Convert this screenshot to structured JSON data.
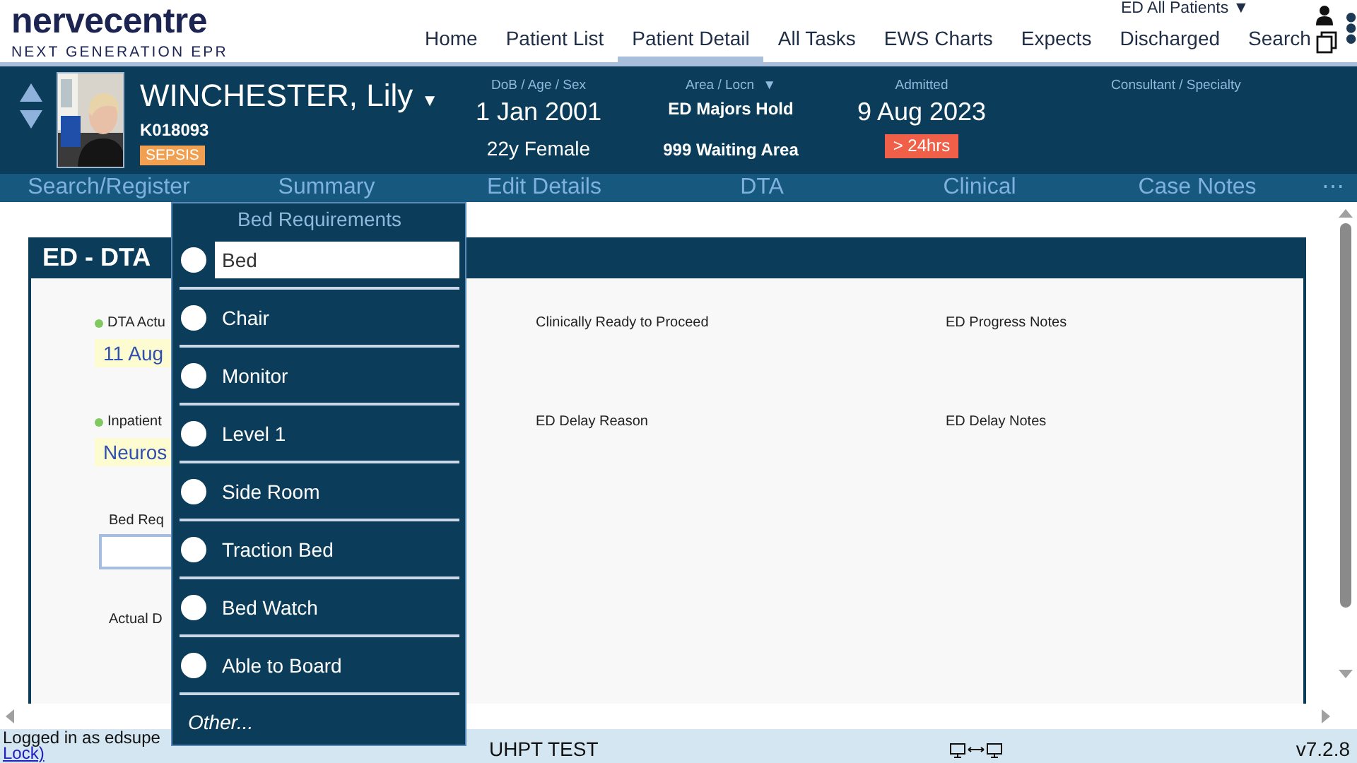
{
  "logo": {
    "name": "nervecentre",
    "tagline": "NEXT GENERATION EPR"
  },
  "nav": [
    {
      "label": "Home",
      "selected": false
    },
    {
      "label": "Patient List",
      "selected": false
    },
    {
      "label": "Patient Detail",
      "selected": true
    },
    {
      "label": "All Tasks",
      "selected": false
    },
    {
      "label": "EWS Charts",
      "selected": false
    },
    {
      "label": "Expects",
      "selected": false
    },
    {
      "label": "Discharged",
      "selected": false
    },
    {
      "label": "Search",
      "selected": false
    }
  ],
  "ward_selector": {
    "label": "ED All Patients",
    "caret": "▼"
  },
  "patient": {
    "name": "WINCHESTER, Lily",
    "caret": "▼",
    "id": "K018093",
    "alert": "SEPSIS",
    "dob_label": "DoB / Age / Sex",
    "dob": "1 Jan 2001",
    "age_sex": "22y Female",
    "area_label": "Area / Locn",
    "area_caret": "▼",
    "area": "ED Majors Hold",
    "location": "999 Waiting Area",
    "admitted_label": "Admitted",
    "admitted": "9 Aug 2023",
    "wait": "> 24hrs",
    "consultant_label": "Consultant / Specialty"
  },
  "subtabs": [
    {
      "label": "Search/Register"
    },
    {
      "label": "Summary"
    },
    {
      "label": "Edit Details"
    },
    {
      "label": "DTA"
    },
    {
      "label": "Clinical"
    },
    {
      "label": "Case Notes"
    }
  ],
  "subtabs_more": "⋯",
  "panel": {
    "title": "ED - DTA",
    "rows": [
      [
        {
          "kind": "value",
          "label": "DTA Actu",
          "dot": true,
          "value": "11 Aug"
        },
        {
          "kind": "text",
          "label": "Clinically Ready to Proceed",
          "dot": false
        },
        {
          "kind": "text",
          "label": "ED Progress Notes",
          "dot": false
        }
      ],
      [
        {
          "kind": "value",
          "label": "Inpatient",
          "dot": true,
          "value": "Neuros"
        },
        {
          "kind": "text",
          "label": "ED Delay Reason",
          "dot": false
        },
        {
          "kind": "text",
          "label": "ED Delay Notes",
          "dot": false
        }
      ],
      [
        {
          "kind": "input",
          "label": "Bed Req",
          "dot": false
        }
      ],
      [
        {
          "kind": "text",
          "label": "Actual D",
          "dot": false
        }
      ]
    ]
  },
  "popup": {
    "title": "Bed Requirements",
    "options": [
      {
        "label": "Bed",
        "selected": true,
        "checked": false
      },
      {
        "label": "Chair",
        "selected": false,
        "checked": false
      },
      {
        "label": "Monitor",
        "selected": false,
        "checked": false
      },
      {
        "label": "Level 1",
        "selected": false,
        "checked": false
      },
      {
        "label": "Side Room",
        "selected": false,
        "checked": false
      },
      {
        "label": "Traction Bed",
        "selected": false,
        "checked": false
      },
      {
        "label": "Bed Watch",
        "selected": false,
        "checked": false
      },
      {
        "label": "Able to Board",
        "selected": false,
        "checked": false
      }
    ],
    "other": "Other..."
  },
  "status_bar": {
    "user": "Logged in as edsupe",
    "link": "Lock)",
    "environment": "UHPT TEST",
    "version": "v7.2.8"
  }
}
